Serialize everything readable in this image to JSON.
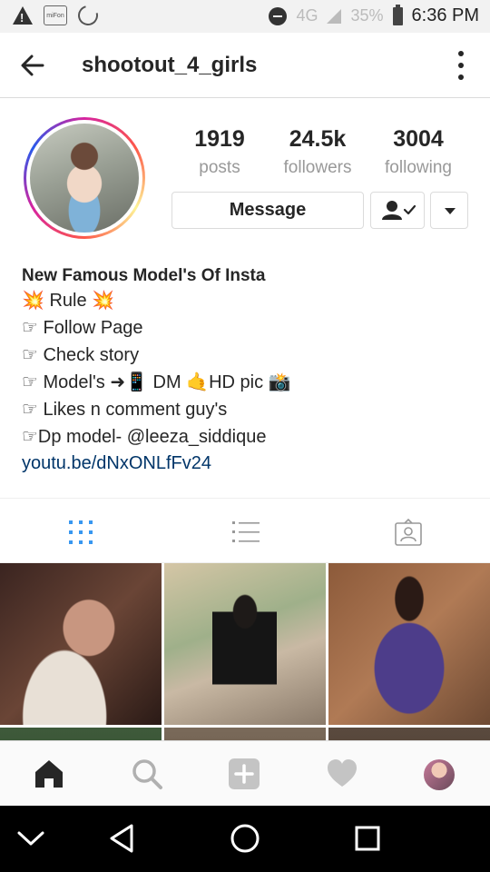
{
  "status_bar": {
    "network": "4G",
    "network_superscript": "4G",
    "battery_percent": "35%",
    "time": "6:36 PM",
    "icons": [
      "warning-icon",
      "mifon-app-icon",
      "sync-app-icon",
      "do-not-disturb-icon",
      "signal-icon",
      "battery-icon"
    ]
  },
  "header": {
    "username": "shootout_4_girls",
    "back_icon": "arrow-left-icon",
    "menu_icon": "more-vertical-icon"
  },
  "profile": {
    "stats": [
      {
        "value": "1919",
        "label": "posts"
      },
      {
        "value": "24.5k",
        "label": "followers"
      },
      {
        "value": "3004",
        "label": "following"
      }
    ],
    "message_label": "Message",
    "follow_icon": "following-check-icon",
    "dropdown_icon": "triangle-down-icon"
  },
  "bio": {
    "name": "New Famous Model's Of Insta",
    "lines": [
      "💥 Rule 💥",
      "☞ Follow Page",
      "☞ Check story",
      "☞ Model's ➜📱 DM 🤙HD pic 📸",
      "☞ Likes n comment guy's",
      "☞Dp model- @leeza_siddique"
    ],
    "link": "youtu.be/dNxONLfFv24"
  },
  "tabs": [
    {
      "name": "grid",
      "icon": "grid-icon",
      "active": true
    },
    {
      "name": "list",
      "icon": "list-icon",
      "active": false
    },
    {
      "name": "tagged",
      "icon": "tagged-icon",
      "active": false
    }
  ],
  "colors": {
    "accent_blue": "#3897f0",
    "link": "#003569",
    "text": "#262626",
    "muted": "#999999",
    "border": "#dbdbdb"
  },
  "bottom_nav": [
    "home-icon",
    "search-icon",
    "add-icon",
    "heart-icon",
    "profile-avatar"
  ],
  "system_nav": [
    "chevron-down-icon",
    "back-triangle-icon",
    "home-circle-icon",
    "recents-square-icon"
  ]
}
